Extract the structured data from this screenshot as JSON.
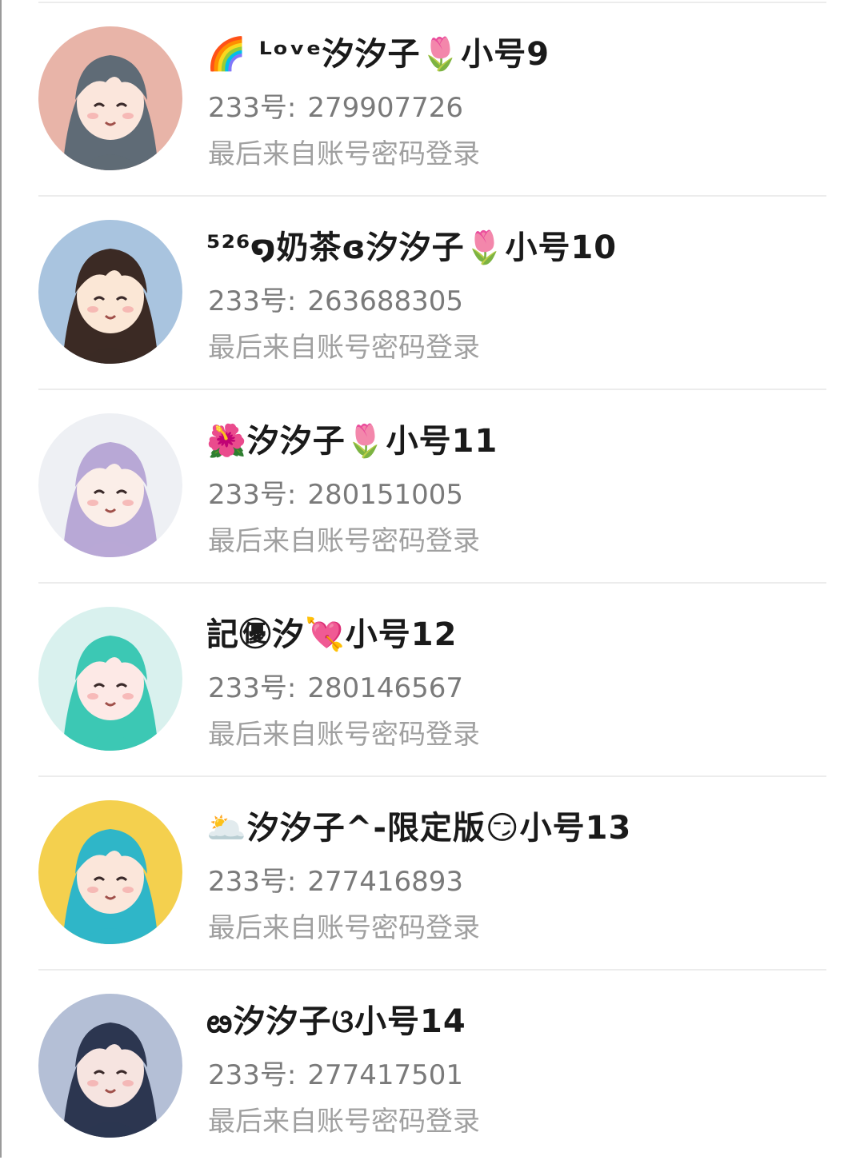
{
  "accounts": [
    {
      "name": "🌈 ᴸᵒᵛᵉ汐汐子🌷小号9",
      "id_label": "233号:",
      "id_value": "279907726",
      "login_method": "最后来自账号密码登录",
      "avatar": {
        "name": "avatar-girl-gray-hair-icon",
        "bg": "#e8b4a8",
        "hair": "#5f6b76",
        "skin": "#fbe6dc"
      }
    },
    {
      "name": "⁵²⁶໑奶茶ɞ汐汐子🌷小号10",
      "id_label": "233号:",
      "id_value": "263688305",
      "login_method": "最后来自账号密码登录",
      "avatar": {
        "name": "avatar-girl-dark-hair-icon",
        "bg": "#a9c4df",
        "hair": "#3b2a24",
        "skin": "#fbe7d6"
      }
    },
    {
      "name": "🌺汐汐子🌷小号11",
      "id_label": "233号:",
      "id_value": "280151005",
      "login_method": "最后来自账号密码登录",
      "avatar": {
        "name": "avatar-girl-purple-hair-icon",
        "bg": "#eef0f4",
        "hair": "#b8a8d6",
        "skin": "#fbeee8"
      }
    },
    {
      "name": "記㊝汐💘小号12",
      "id_label": "233号:",
      "id_value": "280146567",
      "login_method": "最后来自账号密码登录",
      "avatar": {
        "name": "avatar-girl-teal-hair-icon",
        "bg": "#d9f1ee",
        "hair": "#3cc8b4",
        "skin": "#fde9e6"
      }
    },
    {
      "name": "🌥️汐汐子^-限定版😏小号13",
      "id_label": "233号:",
      "id_value": "277416893",
      "login_method": "最后来自账号密码登录",
      "avatar": {
        "name": "avatar-girl-colorful-icon",
        "bg": "#f4d04e",
        "hair": "#2fb6c8",
        "skin": "#fbe6da"
      }
    },
    {
      "name": "ఴ汐汐子ଓ小号14",
      "id_label": "233号:",
      "id_value": "277417501",
      "login_method": "最后来自账号密码登录",
      "avatar": {
        "name": "avatar-girl-navy-hair-icon",
        "bg": "#b4bfd6",
        "hair": "#2c3650",
        "skin": "#f6e4e0"
      }
    }
  ]
}
